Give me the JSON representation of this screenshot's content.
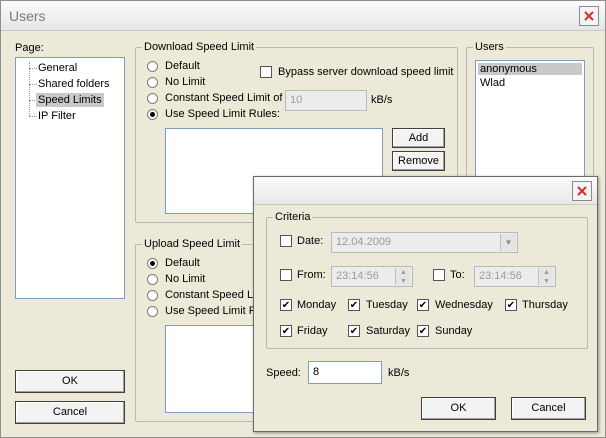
{
  "window": {
    "title": "Users"
  },
  "page_panel": {
    "label": "Page:",
    "items": [
      "General",
      "Shared folders",
      "Speed Limits",
      "IP Filter"
    ],
    "selected_index": 2
  },
  "download": {
    "title": "Download Speed Limit",
    "options": [
      "Default",
      "No Limit",
      "Constant Speed Limit of",
      "Use Speed Limit Rules:"
    ],
    "selected_index": 3,
    "bypass_label": "Bypass server download speed limit",
    "constant_value": "10",
    "unit": "kB/s",
    "add_label": "Add",
    "remove_label": "Remove"
  },
  "upload": {
    "title": "Upload Speed Limit",
    "options": [
      "Default",
      "No Limit",
      "Constant Speed Limi",
      "Use Speed Limit Ru"
    ],
    "selected_index": 0
  },
  "users_panel": {
    "label": "Users",
    "items": [
      "anonymous",
      "Wlad"
    ],
    "selected_index": 0
  },
  "main_buttons": {
    "ok": "OK",
    "cancel": "Cancel"
  },
  "rule_dialog": {
    "criteria_label": "Criteria",
    "date_label": "Date:",
    "date_value": "12.04.2009",
    "from_label": "From:",
    "from_value": "23:14:56",
    "to_label": "To:",
    "to_value": "23:14:56",
    "days": [
      {
        "label": "Monday",
        "checked": true
      },
      {
        "label": "Tuesday",
        "checked": true
      },
      {
        "label": "Wednesday",
        "checked": true
      },
      {
        "label": "Thursday",
        "checked": true
      },
      {
        "label": "Friday",
        "checked": true
      },
      {
        "label": "Saturday",
        "checked": true
      },
      {
        "label": "Sunday",
        "checked": true
      }
    ],
    "speed_label": "Speed:",
    "speed_value": "8",
    "speed_unit": "kB/s",
    "ok": "OK",
    "cancel": "Cancel"
  },
  "colors": {
    "face": "#ece9d8",
    "selection": "#c9c9c9",
    "close_x": "#d03030"
  }
}
